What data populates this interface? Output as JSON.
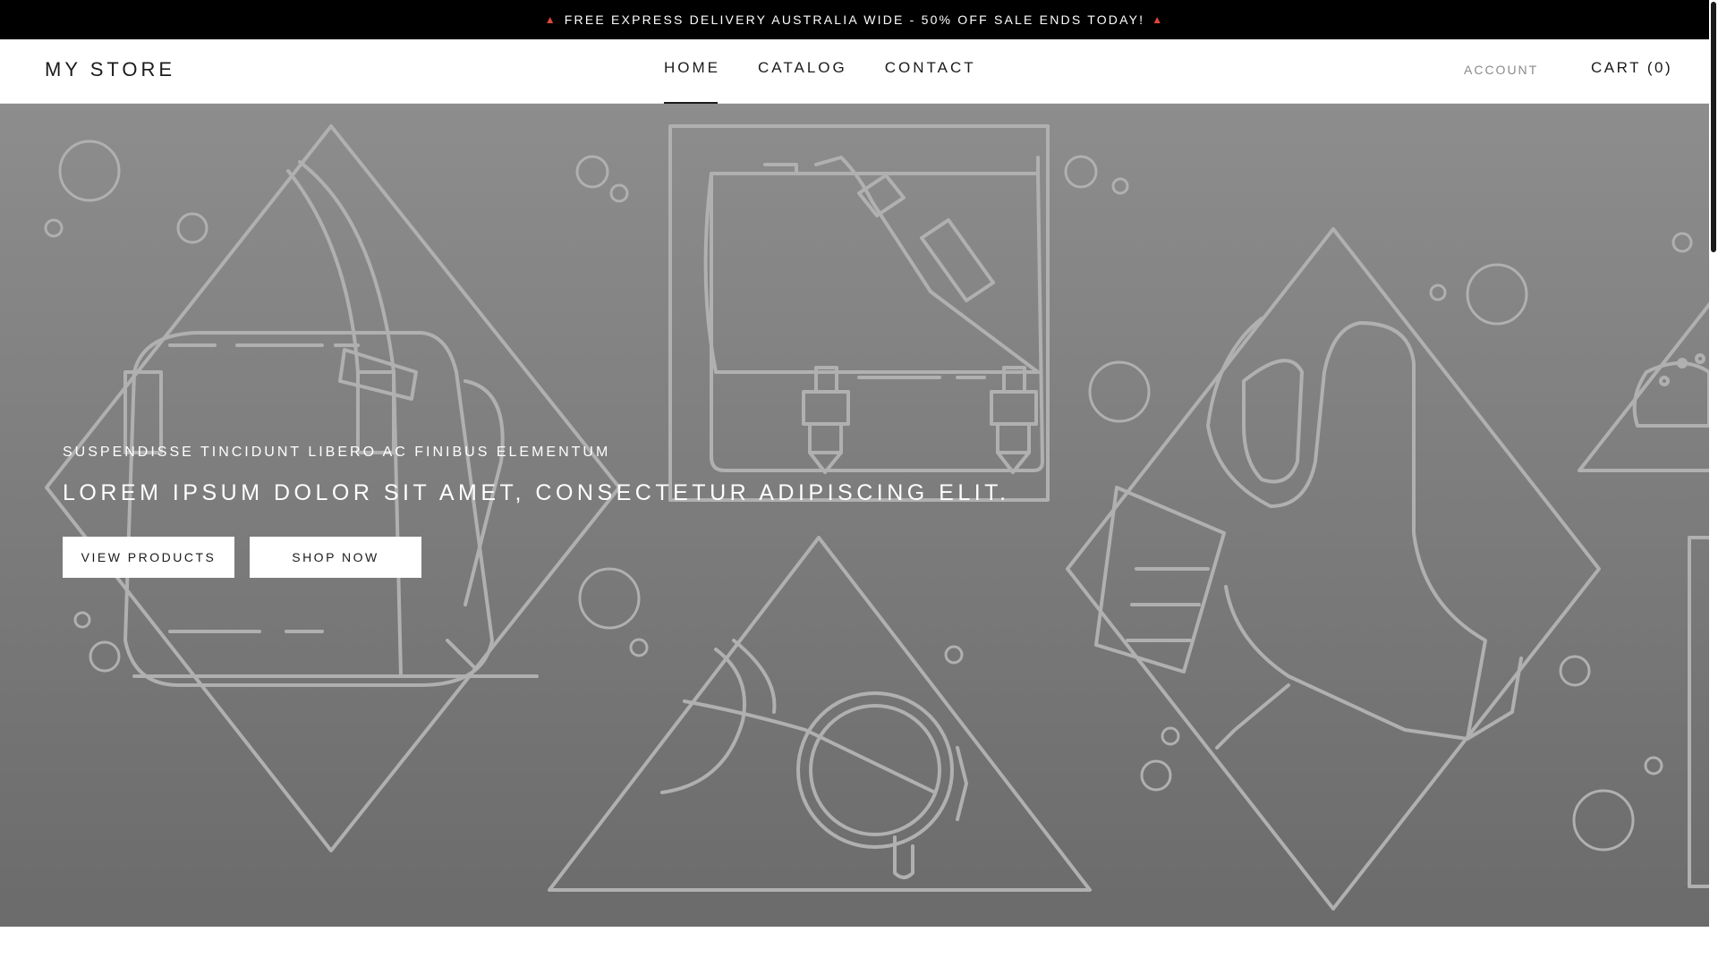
{
  "announcement": {
    "text": "FREE EXPRESS DELIVERY AUSTRALIA WIDE - 50% OFF SALE ENDS TODAY!",
    "icon_left": "siren-icon",
    "icon_right": "siren-icon"
  },
  "header": {
    "logo": "MY STORE",
    "nav": [
      {
        "label": "HOME",
        "active": true
      },
      {
        "label": "CATALOG"
      },
      {
        "label": "CONTACT"
      }
    ],
    "account": "ACCOUNT",
    "cart": "CART (0)"
  },
  "hero": {
    "subtitle": "SUSPENDISSE TINCIDUNT LIBERO AC FINIBUS ELEMENTUM",
    "title": "LOREM IPSUM DOLOR SIT AMET, CONSECTETUR ADIPISCING ELIT.",
    "buttons": [
      "VIEW PRODUCTS",
      "SHOP NOW"
    ],
    "illustration": [
      "handbag-illustration",
      "satchel-illustration",
      "high-heel-shoe-illustration",
      "sunglasses-illustration",
      "sneaker-illustration"
    ]
  },
  "colors": {
    "announcement_bg": "#000000",
    "text_dark": "#1c1b1b",
    "hero_gradient_top": "#8d8d8d",
    "hero_gradient_bottom": "#6b6b6b",
    "line_art": "#b0b0b0"
  }
}
